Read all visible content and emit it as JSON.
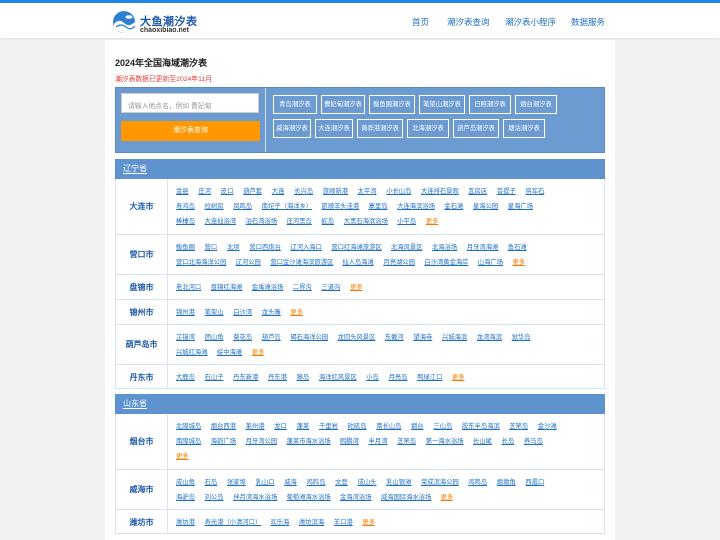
{
  "header": {
    "logo_title": "大鱼潮汐表",
    "logo_sub": "chaoxibiao.net",
    "nav": [
      "首页",
      "潮汐表查询",
      "潮汐表小程序",
      "数据服务"
    ]
  },
  "page": {
    "title": "2024年全国海域潮汐表",
    "notice": "潮汐表数据已更新至2024年11月"
  },
  "search": {
    "placeholder": "请输入地点名，例如 曹妃甸",
    "button": "潮汐表查询"
  },
  "quick_links": [
    "青岛潮汐表",
    "曹妃甸潮汐表",
    "鲅鱼圈潮汐表",
    "笔架山潮汐表",
    "日照潮汐表",
    "烟台潮汐表",
    "威海潮汐表",
    "大连潮汐表",
    "黄骅港潮汐表",
    "北海潮汐表",
    "葫芦岛潮汐表",
    "塘沽潮汐表"
  ],
  "regions": [
    {
      "name": "辽宁省",
      "cities": [
        {
          "name": "大连市",
          "places": [
            [
              "金县",
              "庄河",
              "皮口",
              "葫芦套",
              "大连",
              "长兴岛",
              "旅顺新港",
              "太平湾",
              "小长山岛",
              "大连排石景观",
              "瓦房店",
              "菩提子",
              "将军石"
            ],
            [
              "寿鸿岛",
              "拉树房",
              "凤鸣岛",
              "南坨子（海洋乡）",
              "旅顺羊头洼港",
              "寨里岛",
              "大连海滨浴场",
              "金石滩",
              "星海公园",
              "星海广场"
            ],
            [
              "棒棰岛",
              "大连仙浴湾",
              "泊石湾浴场",
              "庄河黑岛",
              "蛇岛",
              "大黑石海滨浴场",
              "小平岛",
              "更多"
            ]
          ]
        },
        {
          "name": "营口市",
          "places": [
            [
              "鲅鱼圈",
              "营口",
              "北坝",
              "营口西炮台",
              "辽河入海口",
              "营口红海滩旅游区",
              "北海风景区",
              "北海浴场",
              "月牙湾海滩",
              "鱼石滩"
            ],
            [
              "营口北海海洋公园",
              "辽河公园",
              "营口金沙滩海滨旅游区",
              "仙人岛海滩",
              "月亮湖公园",
              "白沙湾黄金海岸",
              "山海广场",
              "更多"
            ]
          ]
        },
        {
          "name": "盘锦市",
          "places": [
            [
              "老北河口",
              "盘锦红海滩",
              "金禹滩浴场",
              "二界沟",
              "三道沟",
              "更多"
            ]
          ]
        },
        {
          "name": "锦州市",
          "places": [
            [
              "锦州港",
              "笔架山",
              "白沙湾",
              "龙头嘴",
              "更多"
            ]
          ]
        },
        {
          "name": "葫芦岛市",
          "places": [
            [
              "芷锚湾",
              "团山角",
              "菊花岛",
              "葫芦岛",
              "碣石海洋公园",
              "龙回头风景区",
              "东戴河",
              "望海寺",
              "兴城海滨",
              "龙湾海滨",
              "觉华岛"
            ],
            [
              "兴城红海滩",
              "绥中海滩",
              "更多"
            ]
          ]
        },
        {
          "name": "丹东市",
          "places": [
            [
              "大鹿岛",
              "石山子",
              "丹东新港",
              "丹东港",
              "獐岛",
              "海洋红风景区",
              "小岛",
              "月亮岛",
              "鸭绿江口",
              "更多"
            ]
          ]
        }
      ]
    },
    {
      "name": "山东省",
      "cities": [
        {
          "name": "烟台市",
          "places": [
            [
              "北隍城岛",
              "烟台西港",
              "莱州港",
              "龙口",
              "蓬莱",
              "千里岩",
              "砣矶岛",
              "南长山岛",
              "烟台",
              "三山岛",
              "胶东半岛海滨",
              "芝罘岛",
              "金沙滩"
            ],
            [
              "南隍城岛",
              "海韵广场",
              "月牙湾公园",
              "蓬莱市海水浴场",
              "鸥鹏湾",
              "半月湾",
              "芝罘岛",
              "第一海水浴场",
              "长山尾",
              "长岛",
              "养马岛"
            ],
            [
              "更多"
            ]
          ]
        },
        {
          "name": "威海市",
          "places": [
            [
              "成山角",
              "石岛",
              "张家埠",
              "乳山口",
              "威海",
              "鸡鸣岛",
              "文登",
              "成山头",
              "乳山银滩",
              "荣成滨海公园",
              "鸡鸣岛",
              "烟墩角",
              "西霞口"
            ],
            [
              "海驴岛",
              "刘公岛",
              "伴月湾海水浴场",
              "葡萄滩海水浴场",
              "金海湾浴场",
              "威海国际海水浴场",
              "更多"
            ]
          ]
        },
        {
          "name": "潍坊市",
          "places": [
            [
              "潍坊港",
              "寿光港（小清河口）",
              "欢乐海",
              "潍坊滨海",
              "羊口港",
              "更多"
            ]
          ]
        }
      ]
    }
  ],
  "colors": {
    "accent": "#1e88e5",
    "region_bar": "#5f93cf",
    "search_panel": "#6c9bd2",
    "orange": "#ff9800",
    "link": "#1e6fc4"
  }
}
